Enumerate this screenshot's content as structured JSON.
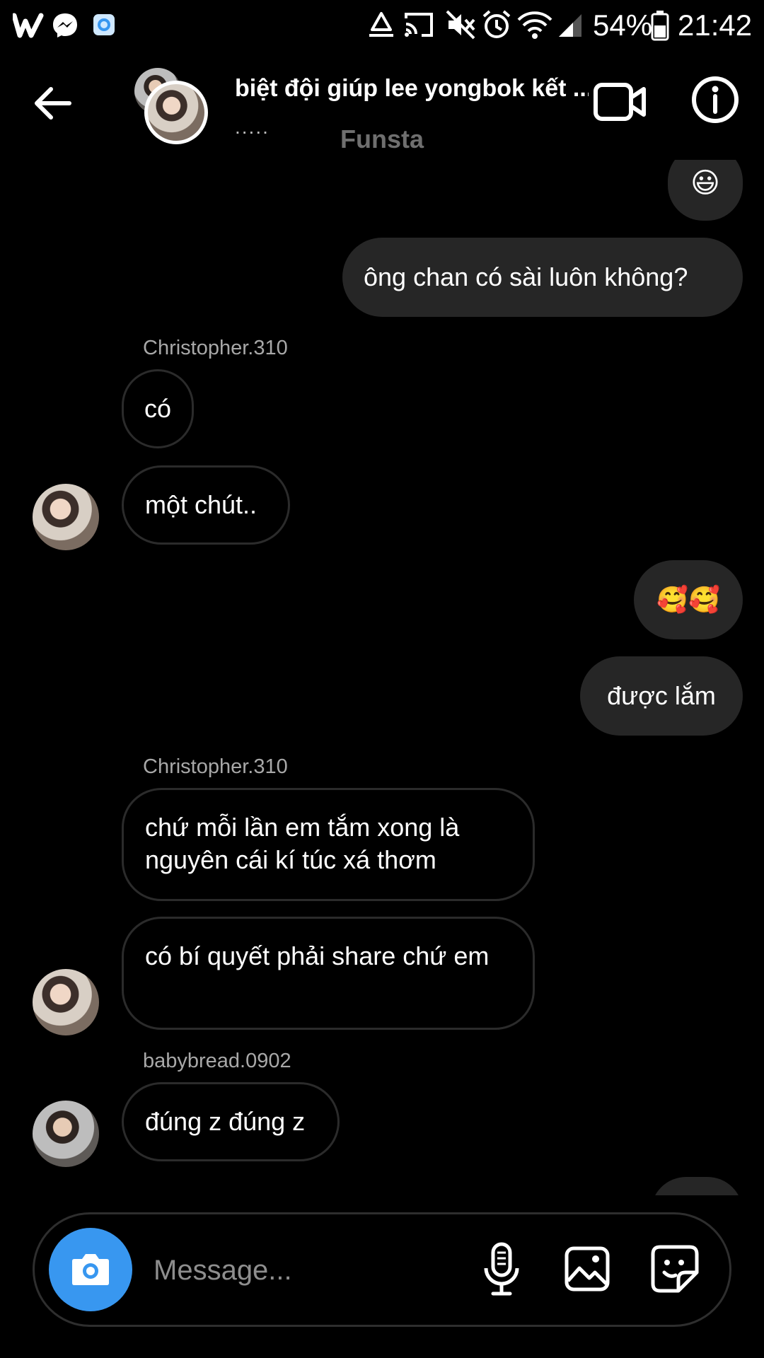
{
  "status_bar": {
    "battery": "54%",
    "time": "21:42"
  },
  "header": {
    "title": "biệt đội giúp lee yongbok kết ...",
    "subtitle": ".....",
    "watermark": "Funsta"
  },
  "messages": [
    {
      "kind": "out",
      "text": "😃"
    },
    {
      "kind": "out",
      "text": "ông chan có sài luôn không?"
    },
    {
      "kind": "sender",
      "text": "Christopher.310"
    },
    {
      "kind": "in",
      "text": "có"
    },
    {
      "kind": "in",
      "text": "một chút.."
    },
    {
      "kind": "out",
      "text": "🥰🥰"
    },
    {
      "kind": "out",
      "text": "được lắm"
    },
    {
      "kind": "sender",
      "text": "Christopher.310"
    },
    {
      "kind": "in",
      "text": "chứ mỗi lần em tắm xong là nguyên cái kí túc xá thơm"
    },
    {
      "kind": "in",
      "text": "có bí quyết phải share chứ em"
    },
    {
      "kind": "sender",
      "text": "babybread.0902"
    },
    {
      "kind": "in",
      "text": "đúng z đúng z"
    }
  ],
  "composer": {
    "placeholder": "Message..."
  },
  "colors": {
    "background": "#000000",
    "outgoing_bubble": "#262626",
    "incoming_border": "#2b2b2b",
    "camera_button": "#3897f0"
  },
  "icons": [
    "wattpad-icon",
    "messenger-icon",
    "app-icon",
    "recycle-icon",
    "cast-icon",
    "mute-icon",
    "alarm-icon",
    "wifi-icon",
    "signal-icon",
    "battery-icon",
    "back-arrow-icon",
    "video-call-icon",
    "info-icon",
    "camera-icon",
    "microphone-icon",
    "gallery-icon",
    "sticker-icon"
  ]
}
